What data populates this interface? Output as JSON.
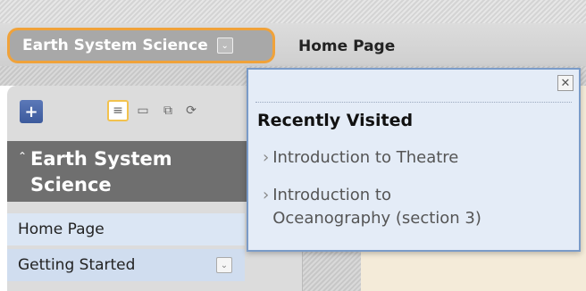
{
  "breadcrumb": {
    "course": "Earth System Science",
    "current_page": "Home Page"
  },
  "sidebar": {
    "course_title": "Earth System Science",
    "items": [
      {
        "label": "Home Page"
      },
      {
        "label": "Getting Started"
      }
    ]
  },
  "recently_visited": {
    "heading": "Recently Visited",
    "links": [
      {
        "line1": "Introduction to Theatre",
        "line2": ""
      },
      {
        "line1": "Introduction to",
        "line2": "Oceanography (section 3)"
      }
    ],
    "close_label": "✕"
  },
  "icons": {
    "plus": "+",
    "caret_up": "⌃",
    "chevron": "⌄",
    "arrow": "›"
  },
  "colors": {
    "highlight_border": "#f0a23a",
    "popup_border": "#7a9bc8",
    "menu_bg": "#dbe6f4",
    "course_head_bg": "#6f6f6f"
  }
}
